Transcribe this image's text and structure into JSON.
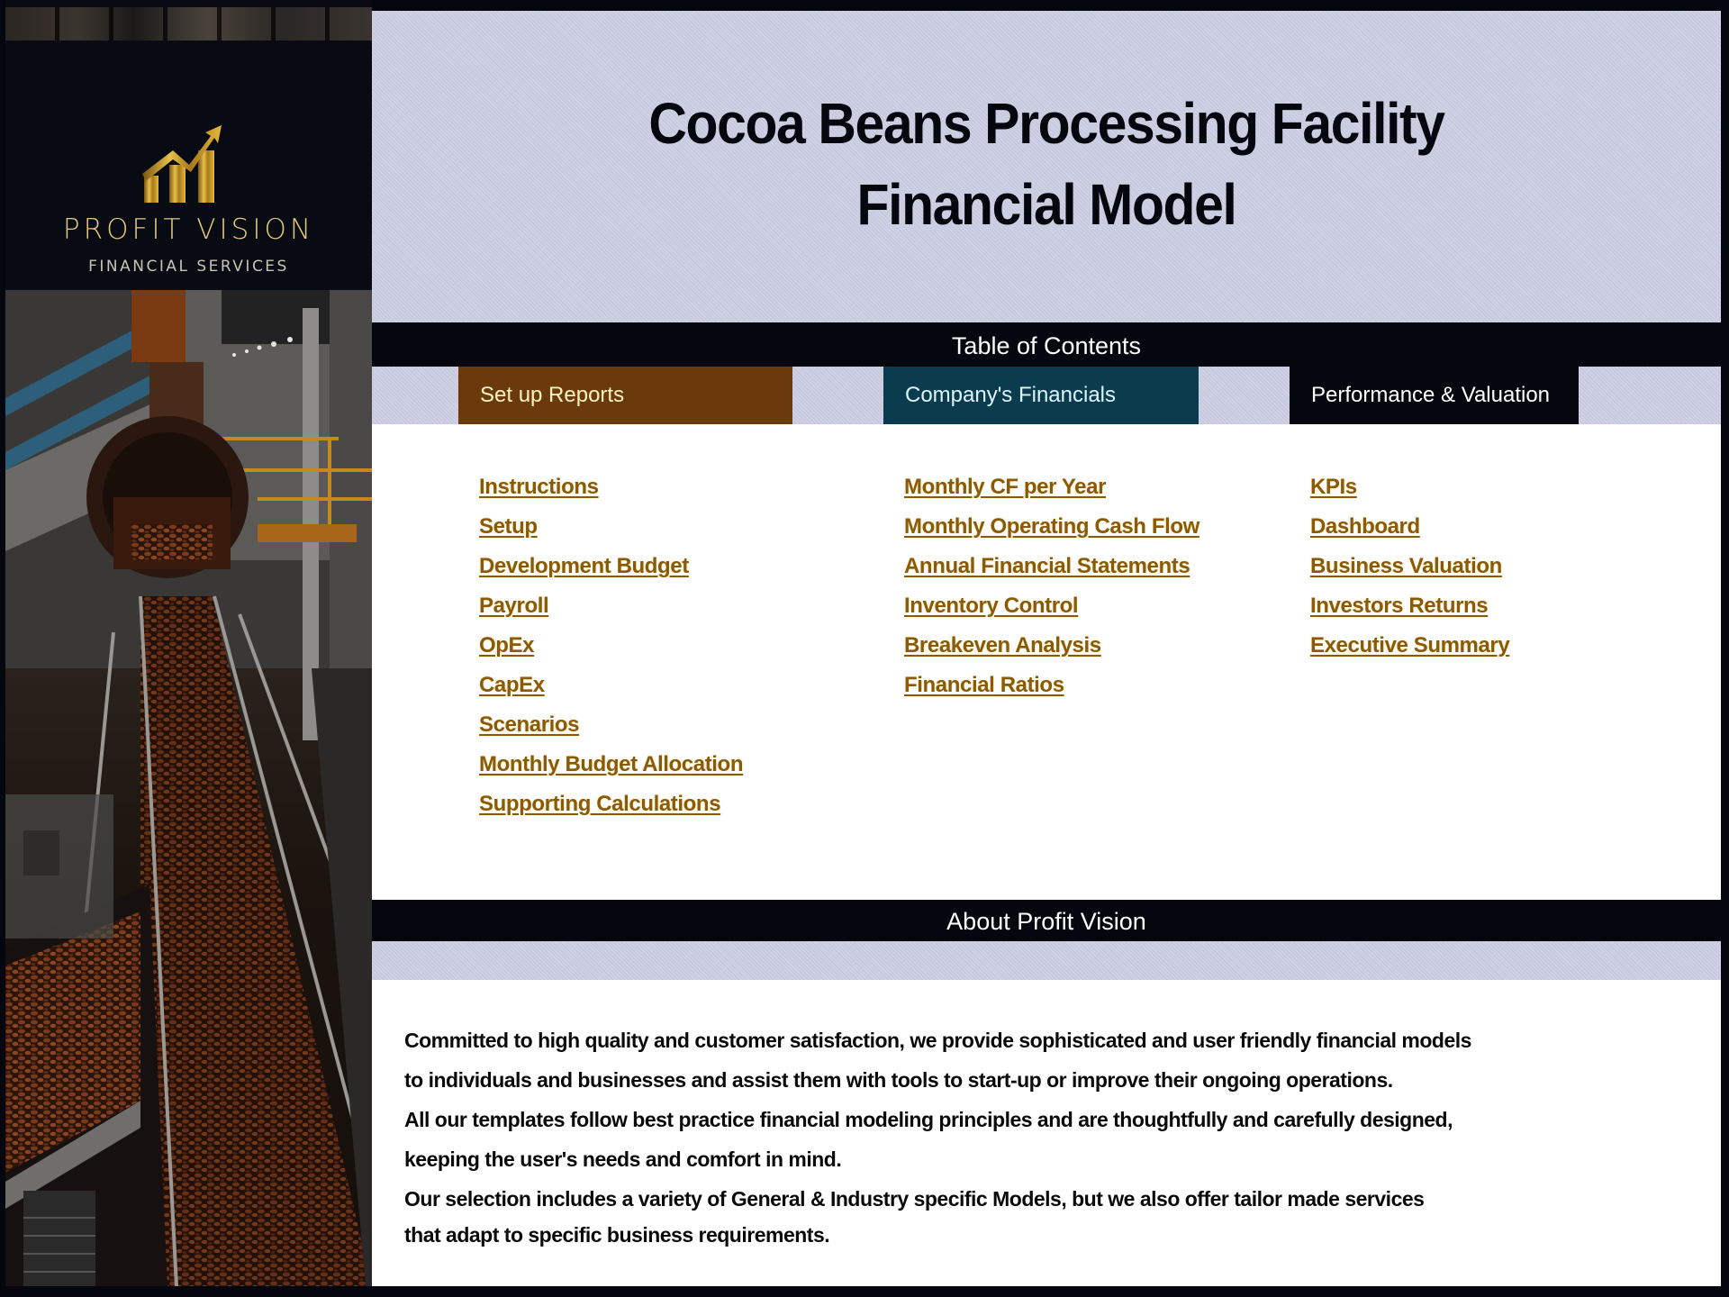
{
  "brand": {
    "name": "PROFIT VISION",
    "tagline": "FINANCIAL SERVICES",
    "logo_icon": "rising-bar-chart-arrow-icon",
    "gold": "#e3c77a"
  },
  "header": {
    "title_line1": "Cocoa Beans Processing Facility",
    "title_line2": "Financial Model"
  },
  "toc": {
    "heading": "Table of Contents",
    "sections": [
      {
        "label": "Set up Reports",
        "color": "#6b3a0a",
        "links": [
          "Instructions",
          "Setup",
          "Development Budget",
          "Payroll",
          "OpEx",
          "CapEx",
          "Scenarios",
          "Monthly Budget Allocation",
          "Supporting Calculations"
        ]
      },
      {
        "label": "Company's Financials",
        "color": "#0b3c4e",
        "links": [
          "Monthly CF per Year",
          "Monthly Operating Cash Flow",
          "Annual Financial Statements",
          "Inventory Control",
          "Breakeven Analysis",
          "Financial Ratios"
        ]
      },
      {
        "label": "Performance & Valuation",
        "color": "#05070f",
        "links": [
          "KPIs",
          "Dashboard",
          "Business Valuation",
          "Investors Returns",
          "Executive Summary"
        ]
      }
    ],
    "link_color": "#8a5a08"
  },
  "about": {
    "heading": "About Profit Vision",
    "lines": [
      "Committed to high quality and customer satisfaction, we provide sophisticated and user friendly financial models",
      "to individuals and businesses and assist them  with tools to start-up or improve their ongoing operations.",
      "All our templates follow best practice financial modeling principles and are thoughtfully and carefully designed,",
      "keeping the user's needs and comfort in mind.",
      "Our selection includes a variety of General & Industry specific Models, but we also offer tailor made services",
      "that adapt to specific business requirements."
    ]
  },
  "photo": {
    "subject": "cocoa-beans-conveyor-photo"
  }
}
